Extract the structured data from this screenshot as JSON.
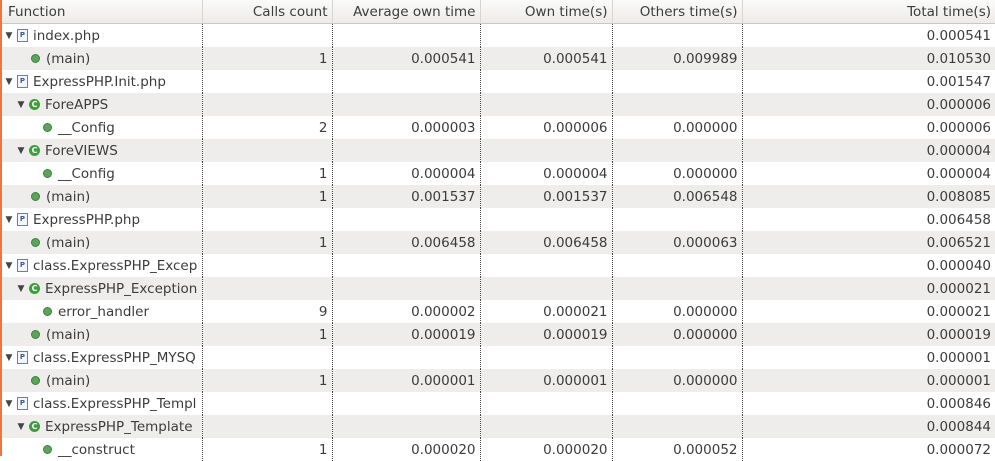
{
  "colors": {
    "accent_edge": "#f0743e",
    "class_icon": "#3e9e3e",
    "func_icon": "#5aa55a",
    "file_icon": "#3b5b98"
  },
  "columns": {
    "function": "Function",
    "calls": "Calls count",
    "avg": "Average own time",
    "own": "Own time(s)",
    "others": "Others time(s)",
    "total": "Total time(s)"
  },
  "rows": [
    {
      "name": "index.php",
      "type": "file",
      "level": 0,
      "calls": "",
      "avg": "",
      "own": "",
      "others": "",
      "total": "0.000541"
    },
    {
      "name": "(main)",
      "type": "function",
      "level": 1,
      "calls": "1",
      "avg": "0.000541",
      "own": "0.000541",
      "others": "0.009989",
      "total": "0.010530"
    },
    {
      "name": "ExpressPHP.Init.php",
      "type": "file",
      "level": 0,
      "calls": "",
      "avg": "",
      "own": "",
      "others": "",
      "total": "0.001547"
    },
    {
      "name": "ForeAPPS",
      "type": "class",
      "level": 1,
      "calls": "",
      "avg": "",
      "own": "",
      "others": "",
      "total": "0.000006"
    },
    {
      "name": "__Config",
      "type": "function",
      "level": 2,
      "calls": "2",
      "avg": "0.000003",
      "own": "0.000006",
      "others": "0.000000",
      "total": "0.000006"
    },
    {
      "name": "ForeVIEWS",
      "type": "class",
      "level": 1,
      "calls": "",
      "avg": "",
      "own": "",
      "others": "",
      "total": "0.000004"
    },
    {
      "name": "__Config",
      "type": "function",
      "level": 2,
      "calls": "1",
      "avg": "0.000004",
      "own": "0.000004",
      "others": "0.000000",
      "total": "0.000004"
    },
    {
      "name": "(main)",
      "type": "function",
      "level": 1,
      "calls": "1",
      "avg": "0.001537",
      "own": "0.001537",
      "others": "0.006548",
      "total": "0.008085"
    },
    {
      "name": "ExpressPHP.php",
      "type": "file",
      "level": 0,
      "calls": "",
      "avg": "",
      "own": "",
      "others": "",
      "total": "0.006458"
    },
    {
      "name": "(main)",
      "type": "function",
      "level": 1,
      "calls": "1",
      "avg": "0.006458",
      "own": "0.006458",
      "others": "0.000063",
      "total": "0.006521"
    },
    {
      "name": "class.ExpressPHP_Excep",
      "type": "file",
      "level": 0,
      "calls": "",
      "avg": "",
      "own": "",
      "others": "",
      "total": "0.000040"
    },
    {
      "name": "ExpressPHP_Exception",
      "type": "class",
      "level": 1,
      "calls": "",
      "avg": "",
      "own": "",
      "others": "",
      "total": "0.000021"
    },
    {
      "name": "error_handler",
      "type": "function",
      "level": 2,
      "calls": "9",
      "avg": "0.000002",
      "own": "0.000021",
      "others": "0.000000",
      "total": "0.000021"
    },
    {
      "name": "(main)",
      "type": "function",
      "level": 1,
      "calls": "1",
      "avg": "0.000019",
      "own": "0.000019",
      "others": "0.000000",
      "total": "0.000019"
    },
    {
      "name": "class.ExpressPHP_MYSQ",
      "type": "file",
      "level": 0,
      "calls": "",
      "avg": "",
      "own": "",
      "others": "",
      "total": "0.000001"
    },
    {
      "name": "(main)",
      "type": "function",
      "level": 1,
      "calls": "1",
      "avg": "0.000001",
      "own": "0.000001",
      "others": "0.000000",
      "total": "0.000001"
    },
    {
      "name": "class.ExpressPHP_Templ",
      "type": "file",
      "level": 0,
      "calls": "",
      "avg": "",
      "own": "",
      "others": "",
      "total": "0.000846"
    },
    {
      "name": "ExpressPHP_Template",
      "type": "class",
      "level": 1,
      "calls": "",
      "avg": "",
      "own": "",
      "others": "",
      "total": "0.000844"
    },
    {
      "name": "__construct",
      "type": "function",
      "level": 2,
      "calls": "1",
      "avg": "0.000020",
      "own": "0.000020",
      "others": "0.000052",
      "total": "0.000072"
    }
  ]
}
